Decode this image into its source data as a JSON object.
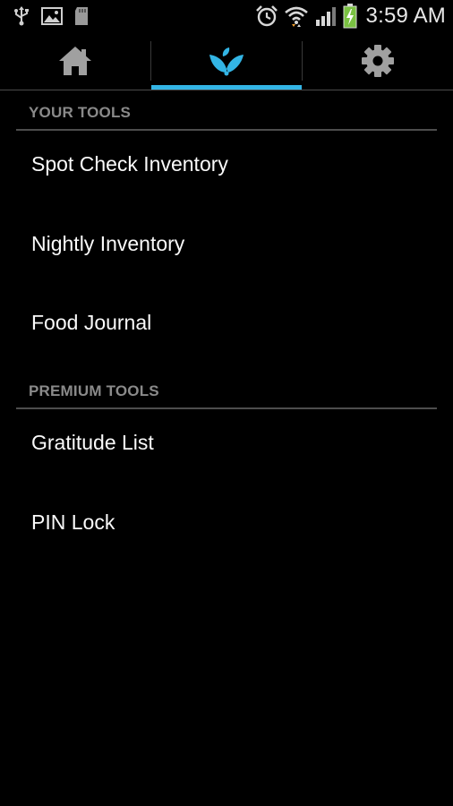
{
  "status_bar": {
    "time": "3:59 AM",
    "icons": [
      "usb-icon",
      "image-icon",
      "sd-card-icon",
      "alarm-icon",
      "wifi-icon",
      "signal-icon",
      "battery-charging-icon"
    ]
  },
  "tabs": [
    {
      "name": "home",
      "icon": "home-icon",
      "selected": false
    },
    {
      "name": "tools",
      "icon": "leaf-logo-icon",
      "selected": true
    },
    {
      "name": "settings",
      "icon": "gear-icon",
      "selected": false
    }
  ],
  "colors": {
    "accent": "#33b5e5",
    "background": "#000000",
    "section_header_text": "#8a8a8a",
    "divider": "#4d4d4d"
  },
  "sections": [
    {
      "title": "YOUR TOOLS",
      "items": [
        "Spot Check Inventory",
        "Nightly Inventory",
        "Food Journal"
      ]
    },
    {
      "title": "PREMIUM TOOLS",
      "items": [
        "Gratitude List",
        "PIN Lock"
      ]
    }
  ]
}
